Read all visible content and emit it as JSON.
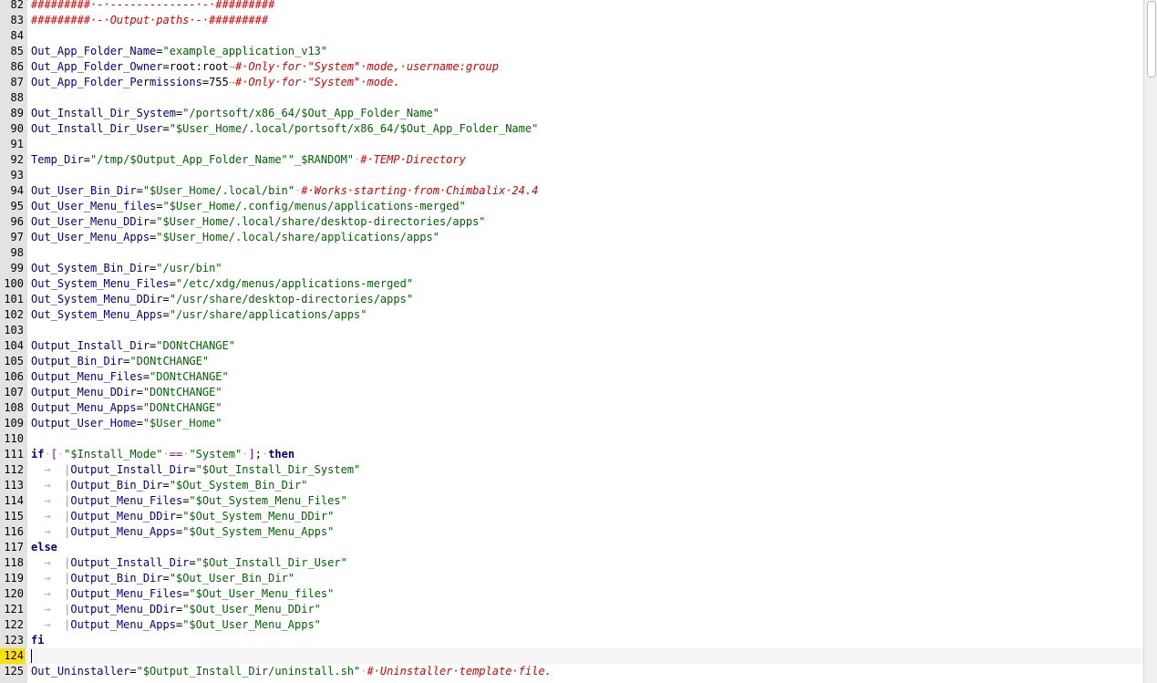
{
  "editor": {
    "current_line": "124",
    "lines": [
      {
        "n": "82",
        "tokens": [
          {
            "c": "comment",
            "t": "#########·-·-------------·-·#########"
          }
        ]
      },
      {
        "n": "83",
        "tokens": [
          {
            "c": "comment",
            "t": "#########·-·Output·paths·-·#########"
          }
        ]
      },
      {
        "n": "84",
        "tokens": []
      },
      {
        "n": "85",
        "tokens": [
          {
            "c": "ident",
            "t": "Out_App_Folder_Name"
          },
          {
            "c": "plain",
            "t": "="
          },
          {
            "c": "string",
            "t": "\"example_application_v13\""
          }
        ]
      },
      {
        "n": "86",
        "tokens": [
          {
            "c": "ident",
            "t": "Out_App_Folder_Owner"
          },
          {
            "c": "plain",
            "t": "=root:root"
          },
          {
            "c": "arrow",
            "t": "→"
          },
          {
            "c": "comment",
            "t": "#·Only·for·\"System\"·mode,·username:group"
          }
        ]
      },
      {
        "n": "87",
        "tokens": [
          {
            "c": "ident",
            "t": "Out_App_Folder_Permissions"
          },
          {
            "c": "plain",
            "t": "=755"
          },
          {
            "c": "arrow",
            "t": "→"
          },
          {
            "c": "comment",
            "t": "#·Only·for·\"System\"·mode."
          }
        ]
      },
      {
        "n": "88",
        "tokens": []
      },
      {
        "n": "89",
        "tokens": [
          {
            "c": "ident",
            "t": "Out_Install_Dir_System"
          },
          {
            "c": "plain",
            "t": "="
          },
          {
            "c": "string",
            "t": "\"/portsoft/x86_64/$Out_App_Folder_Name\""
          }
        ]
      },
      {
        "n": "90",
        "tokens": [
          {
            "c": "ident",
            "t": "Out_Install_Dir_User"
          },
          {
            "c": "plain",
            "t": "="
          },
          {
            "c": "string",
            "t": "\"$User_Home/.local/portsoft/x86_64/$Out_App_Folder_Name\""
          }
        ]
      },
      {
        "n": "91",
        "tokens": []
      },
      {
        "n": "92",
        "tokens": [
          {
            "c": "ident",
            "t": "Temp_Dir"
          },
          {
            "c": "plain",
            "t": "="
          },
          {
            "c": "string",
            "t": "\"/tmp/$Output_App_Folder_Name\"\"_$RANDOM\""
          },
          {
            "c": "arrow",
            "t": "·"
          },
          {
            "c": "comment",
            "t": "#·TEMP·Directory"
          }
        ]
      },
      {
        "n": "93",
        "tokens": []
      },
      {
        "n": "94",
        "tokens": [
          {
            "c": "ident",
            "t": "Out_User_Bin_Dir"
          },
          {
            "c": "plain",
            "t": "="
          },
          {
            "c": "string",
            "t": "\"$User_Home/.local/bin\""
          },
          {
            "c": "arrow",
            "t": "·"
          },
          {
            "c": "comment",
            "t": "#·Works·starting·from·Chimbalix·24.4"
          }
        ]
      },
      {
        "n": "95",
        "tokens": [
          {
            "c": "ident",
            "t": "Out_User_Menu_files"
          },
          {
            "c": "plain",
            "t": "="
          },
          {
            "c": "string",
            "t": "\"$User_Home/.config/menus/applications-merged\""
          }
        ]
      },
      {
        "n": "96",
        "tokens": [
          {
            "c": "ident",
            "t": "Out_User_Menu_DDir"
          },
          {
            "c": "plain",
            "t": "="
          },
          {
            "c": "string",
            "t": "\"$User_Home/.local/share/desktop-directories/apps\""
          }
        ]
      },
      {
        "n": "97",
        "tokens": [
          {
            "c": "ident",
            "t": "Out_User_Menu_Apps"
          },
          {
            "c": "plain",
            "t": "="
          },
          {
            "c": "string",
            "t": "\"$User_Home/.local/share/applications/apps\""
          }
        ]
      },
      {
        "n": "98",
        "tokens": []
      },
      {
        "n": "99",
        "tokens": [
          {
            "c": "ident",
            "t": "Out_System_Bin_Dir"
          },
          {
            "c": "plain",
            "t": "="
          },
          {
            "c": "string",
            "t": "\"/usr/bin\""
          }
        ]
      },
      {
        "n": "100",
        "tokens": [
          {
            "c": "ident",
            "t": "Out_System_Menu_Files"
          },
          {
            "c": "plain",
            "t": "="
          },
          {
            "c": "string",
            "t": "\"/etc/xdg/menus/applications-merged\""
          }
        ]
      },
      {
        "n": "101",
        "tokens": [
          {
            "c": "ident",
            "t": "Out_System_Menu_DDir"
          },
          {
            "c": "plain",
            "t": "="
          },
          {
            "c": "string",
            "t": "\"/usr/share/desktop-directories/apps\""
          }
        ]
      },
      {
        "n": "102",
        "tokens": [
          {
            "c": "ident",
            "t": "Out_System_Menu_Apps"
          },
          {
            "c": "plain",
            "t": "="
          },
          {
            "c": "string",
            "t": "\"/usr/share/applications/apps\""
          }
        ]
      },
      {
        "n": "103",
        "tokens": []
      },
      {
        "n": "104",
        "tokens": [
          {
            "c": "ident",
            "t": "Output_Install_Dir"
          },
          {
            "c": "plain",
            "t": "="
          },
          {
            "c": "string",
            "t": "\"DONtCHANGE\""
          }
        ]
      },
      {
        "n": "105",
        "tokens": [
          {
            "c": "ident",
            "t": "Output_Bin_Dir"
          },
          {
            "c": "plain",
            "t": "="
          },
          {
            "c": "string",
            "t": "\"DONtCHANGE\""
          }
        ]
      },
      {
        "n": "106",
        "tokens": [
          {
            "c": "ident",
            "t": "Output_Menu_Files"
          },
          {
            "c": "plain",
            "t": "="
          },
          {
            "c": "string",
            "t": "\"DONtCHANGE\""
          }
        ]
      },
      {
        "n": "107",
        "tokens": [
          {
            "c": "ident",
            "t": "Output_Menu_DDir"
          },
          {
            "c": "plain",
            "t": "="
          },
          {
            "c": "string",
            "t": "\"DONtCHANGE\""
          }
        ]
      },
      {
        "n": "108",
        "tokens": [
          {
            "c": "ident",
            "t": "Output_Menu_Apps"
          },
          {
            "c": "plain",
            "t": "="
          },
          {
            "c": "string",
            "t": "\"DONtCHANGE\""
          }
        ]
      },
      {
        "n": "109",
        "tokens": [
          {
            "c": "ident",
            "t": "Output_User_Home"
          },
          {
            "c": "plain",
            "t": "="
          },
          {
            "c": "string",
            "t": "\"$User_Home\""
          }
        ]
      },
      {
        "n": "110",
        "tokens": []
      },
      {
        "n": "111",
        "tokens": [
          {
            "c": "keyword",
            "t": "if"
          },
          {
            "c": "arrow",
            "t": "·"
          },
          {
            "c": "op",
            "t": "["
          },
          {
            "c": "arrow",
            "t": "·"
          },
          {
            "c": "string",
            "t": "\"$Install_Mode\""
          },
          {
            "c": "arrow",
            "t": "·"
          },
          {
            "c": "op",
            "t": "=="
          },
          {
            "c": "arrow",
            "t": "·"
          },
          {
            "c": "string",
            "t": "\"System\""
          },
          {
            "c": "arrow",
            "t": "·"
          },
          {
            "c": "op",
            "t": "]"
          },
          {
            "c": "plain",
            "t": ";"
          },
          {
            "c": "arrow",
            "t": "·"
          },
          {
            "c": "keyword",
            "t": "then"
          }
        ]
      },
      {
        "n": "112",
        "tokens": [
          {
            "c": "arrow",
            "t": "  →  "
          },
          {
            "c": "guide",
            "t": "|"
          },
          {
            "c": "ident",
            "t": "Output_Install_Dir"
          },
          {
            "c": "plain",
            "t": "="
          },
          {
            "c": "string",
            "t": "\"$Out_Install_Dir_System\""
          }
        ]
      },
      {
        "n": "113",
        "tokens": [
          {
            "c": "arrow",
            "t": "  →  "
          },
          {
            "c": "guide",
            "t": "|"
          },
          {
            "c": "ident",
            "t": "Output_Bin_Dir"
          },
          {
            "c": "plain",
            "t": "="
          },
          {
            "c": "string",
            "t": "\"$Out_System_Bin_Dir\""
          }
        ]
      },
      {
        "n": "114",
        "tokens": [
          {
            "c": "arrow",
            "t": "  →  "
          },
          {
            "c": "guide",
            "t": "|"
          },
          {
            "c": "ident",
            "t": "Output_Menu_Files"
          },
          {
            "c": "plain",
            "t": "="
          },
          {
            "c": "string",
            "t": "\"$Out_System_Menu_Files\""
          }
        ]
      },
      {
        "n": "115",
        "tokens": [
          {
            "c": "arrow",
            "t": "  →  "
          },
          {
            "c": "guide",
            "t": "|"
          },
          {
            "c": "ident",
            "t": "Output_Menu_DDir"
          },
          {
            "c": "plain",
            "t": "="
          },
          {
            "c": "string",
            "t": "\"$Out_System_Menu_DDir\""
          }
        ]
      },
      {
        "n": "116",
        "tokens": [
          {
            "c": "arrow",
            "t": "  →  "
          },
          {
            "c": "guide",
            "t": "|"
          },
          {
            "c": "ident",
            "t": "Output_Menu_Apps"
          },
          {
            "c": "plain",
            "t": "="
          },
          {
            "c": "string",
            "t": "\"$Out_System_Menu_Apps\""
          }
        ]
      },
      {
        "n": "117",
        "tokens": [
          {
            "c": "keyword",
            "t": "else"
          }
        ]
      },
      {
        "n": "118",
        "tokens": [
          {
            "c": "arrow",
            "t": "  →  "
          },
          {
            "c": "guide",
            "t": "|"
          },
          {
            "c": "ident",
            "t": "Output_Install_Dir"
          },
          {
            "c": "plain",
            "t": "="
          },
          {
            "c": "string",
            "t": "\"$Out_Install_Dir_User\""
          }
        ]
      },
      {
        "n": "119",
        "tokens": [
          {
            "c": "arrow",
            "t": "  →  "
          },
          {
            "c": "guide",
            "t": "|"
          },
          {
            "c": "ident",
            "t": "Output_Bin_Dir"
          },
          {
            "c": "plain",
            "t": "="
          },
          {
            "c": "string",
            "t": "\"$Out_User_Bin_Dir\""
          }
        ]
      },
      {
        "n": "120",
        "tokens": [
          {
            "c": "arrow",
            "t": "  →  "
          },
          {
            "c": "guide",
            "t": "|"
          },
          {
            "c": "ident",
            "t": "Output_Menu_Files"
          },
          {
            "c": "plain",
            "t": "="
          },
          {
            "c": "string",
            "t": "\"$Out_User_Menu_files\""
          }
        ]
      },
      {
        "n": "121",
        "tokens": [
          {
            "c": "arrow",
            "t": "  →  "
          },
          {
            "c": "guide",
            "t": "|"
          },
          {
            "c": "ident",
            "t": "Output_Menu_DDir"
          },
          {
            "c": "plain",
            "t": "="
          },
          {
            "c": "string",
            "t": "\"$Out_User_Menu_DDir\""
          }
        ]
      },
      {
        "n": "122",
        "tokens": [
          {
            "c": "arrow",
            "t": "  →  "
          },
          {
            "c": "guide",
            "t": "|"
          },
          {
            "c": "ident",
            "t": "Output_Menu_Apps"
          },
          {
            "c": "plain",
            "t": "="
          },
          {
            "c": "string",
            "t": "\"$Out_User_Menu_Apps\""
          }
        ]
      },
      {
        "n": "123",
        "tokens": [
          {
            "c": "keyword",
            "t": "fi"
          }
        ]
      },
      {
        "n": "124",
        "tokens": []
      },
      {
        "n": "125",
        "tokens": [
          {
            "c": "ident",
            "t": "Out_Uninstaller"
          },
          {
            "c": "plain",
            "t": "="
          },
          {
            "c": "string",
            "t": "\"$Output_Install_Dir/uninstall.sh\""
          },
          {
            "c": "arrow",
            "t": "·"
          },
          {
            "c": "comment",
            "t": "#·Uninstaller·template·file."
          }
        ]
      }
    ]
  }
}
